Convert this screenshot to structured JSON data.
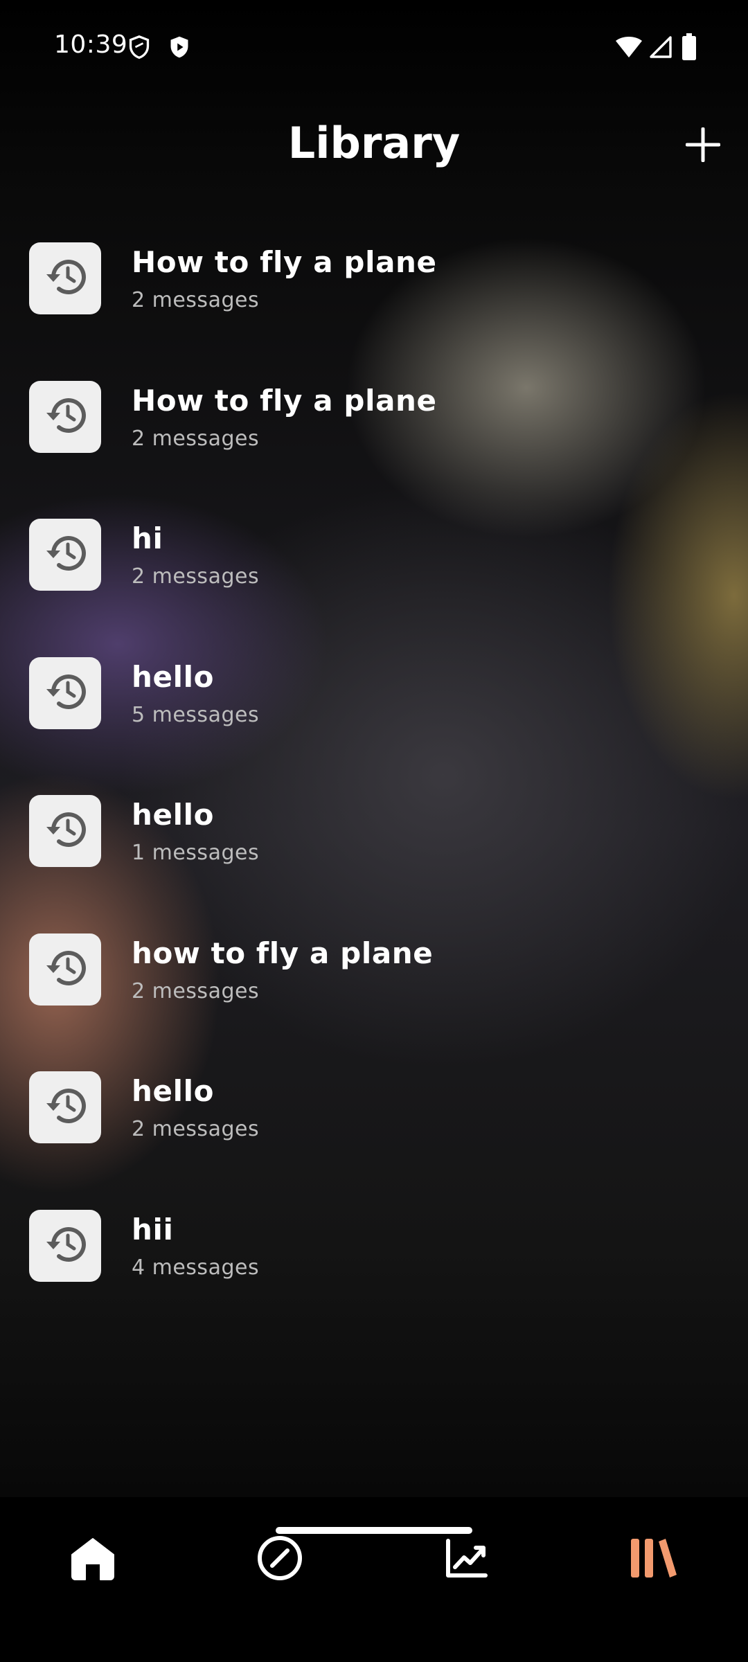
{
  "status": {
    "time": "10:39"
  },
  "header": {
    "title": "Library",
    "add_icon": "plus-icon"
  },
  "sessions": [
    {
      "title": "How to fly a plane",
      "subtitle": "2 messages",
      "icon": "history-icon"
    },
    {
      "title": "How to fly a plane",
      "subtitle": "2 messages",
      "icon": "history-icon"
    },
    {
      "title": "hi",
      "subtitle": "2 messages",
      "icon": "history-icon"
    },
    {
      "title": "hello",
      "subtitle": "5 messages",
      "icon": "history-icon"
    },
    {
      "title": "hello",
      "subtitle": "1 messages",
      "icon": "history-icon"
    },
    {
      "title": "how to fly a plane",
      "subtitle": "2 messages",
      "icon": "history-icon"
    },
    {
      "title": "hello",
      "subtitle": "2 messages",
      "icon": "history-icon"
    },
    {
      "title": "hii",
      "subtitle": "4 messages",
      "icon": "history-icon"
    }
  ],
  "nav": {
    "items": [
      {
        "icon": "home-icon",
        "active": false
      },
      {
        "icon": "compass-icon",
        "active": false
      },
      {
        "icon": "trending-icon",
        "active": false
      },
      {
        "icon": "library-icon",
        "active": true
      }
    ],
    "active_color": "#F29A6E"
  }
}
